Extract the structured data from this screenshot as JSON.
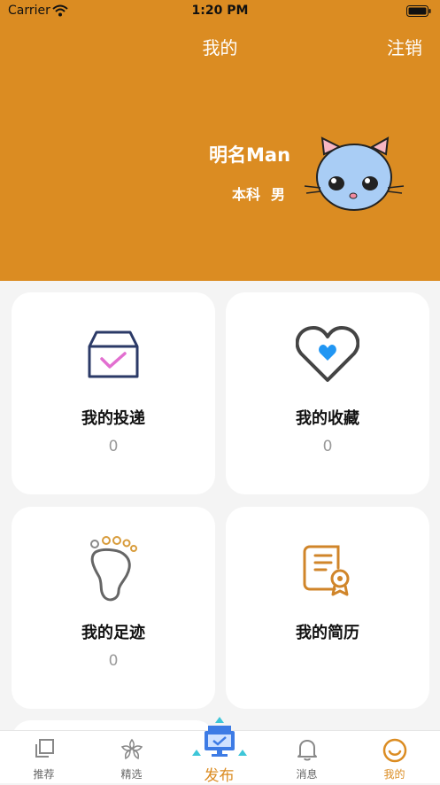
{
  "status_bar": {
    "carrier": "Carrier",
    "time": "1:20 PM"
  },
  "header": {
    "title": "我的",
    "logout_label": "注销"
  },
  "profile": {
    "name": "明名Man",
    "education": "本科",
    "gender": "男",
    "avatar_icon": "cat-avatar-icon"
  },
  "cards": [
    {
      "label": "我的投递",
      "count": "0",
      "icon": "inbox-check-icon"
    },
    {
      "label": "我的收藏",
      "count": "0",
      "icon": "heart-icon"
    },
    {
      "label": "我的足迹",
      "count": "0",
      "icon": "footprint-icon"
    },
    {
      "label": "我的简历",
      "count": "",
      "icon": "resume-certificate-icon"
    }
  ],
  "tabbar": {
    "items": [
      {
        "label": "推荐",
        "icon": "layers-icon"
      },
      {
        "label": "精选",
        "icon": "flower-icon"
      },
      {
        "label": "发布",
        "icon": "publish-icon"
      },
      {
        "label": "消息",
        "icon": "bell-icon"
      },
      {
        "label": "我的",
        "icon": "smile-icon"
      }
    ],
    "active_index": 4
  },
  "colors": {
    "accent": "#db8c22",
    "background": "#f4f4f4",
    "card": "#ffffff",
    "muted": "#999999"
  }
}
